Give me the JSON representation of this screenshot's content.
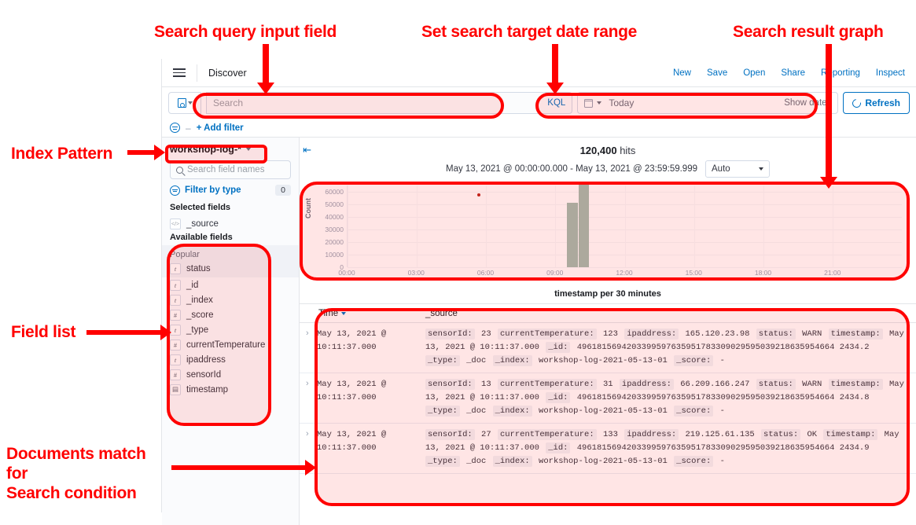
{
  "annotations": [
    {
      "id": "search-query",
      "text": "Search query input field"
    },
    {
      "id": "date-range",
      "text": "Set search target date range"
    },
    {
      "id": "result-graph",
      "text": "Search result graph"
    },
    {
      "id": "index-pattern",
      "text": "Index Pattern"
    },
    {
      "id": "field-list",
      "text": "Field list"
    },
    {
      "id": "documents",
      "text": "Documents match\nfor\nSearch condition"
    }
  ],
  "annotation_color": "#ff0000",
  "topnav": {
    "menu_icon": "hamburger-icon",
    "app_title": "Discover",
    "links": [
      "New",
      "Save",
      "Open",
      "Share",
      "Reporting",
      "Inspect"
    ]
  },
  "query_bar": {
    "saved_query_icon": "save-disk-icon",
    "search_placeholder": "Search",
    "query_language": "KQL",
    "date_icon": "calendar-icon",
    "date_value": "Today",
    "show_dates": "Show dates",
    "refresh_label": "Refresh",
    "refresh_icon": "refresh-icon"
  },
  "filter_bar": {
    "filter_icon": "filter-icon",
    "dash": "–",
    "add_filter": "+ Add filter"
  },
  "sidebar": {
    "index_pattern": "workshop-log-*",
    "collapse_icon": "collapse-panel-icon",
    "field_search_placeholder": "Search field names",
    "filter_by_type": "Filter by type",
    "filter_by_type_count": "0",
    "selected_fields_title": "Selected fields",
    "selected_fields": [
      {
        "name": "_source",
        "type": "source"
      }
    ],
    "available_fields_title": "Available fields",
    "popular_title": "Popular",
    "popular_fields": [
      {
        "name": "status",
        "type": "t"
      }
    ],
    "available_fields": [
      {
        "name": "_id",
        "type": "t"
      },
      {
        "name": "_index",
        "type": "t"
      },
      {
        "name": "_score",
        "type": "#"
      },
      {
        "name": "_type",
        "type": "t"
      },
      {
        "name": "currentTemperature",
        "type": "#"
      },
      {
        "name": "ipaddress",
        "type": "t"
      },
      {
        "name": "sensorId",
        "type": "#"
      },
      {
        "name": "timestamp",
        "type": "date"
      }
    ]
  },
  "main": {
    "hits_count": "120,400",
    "hits_label": "hits",
    "time_range": "May 13, 2021 @ 00:00:00.000 - May 13, 2021 @ 23:59:59.999",
    "interval_selected": "Auto"
  },
  "chart_data": {
    "type": "bar",
    "title": "",
    "xlabel": "timestamp per 30 minutes",
    "ylabel": "Count",
    "ylim": [
      0,
      65000
    ],
    "yticks": [
      0,
      10000,
      20000,
      30000,
      40000,
      50000,
      60000
    ],
    "xlim_hours": [
      0,
      24
    ],
    "xticks": [
      "00:00",
      "03:00",
      "06:00",
      "09:00",
      "12:00",
      "15:00",
      "18:00",
      "21:00"
    ],
    "xtick_hours": [
      0,
      3,
      6,
      9,
      12,
      15,
      18,
      21
    ],
    "grid": true,
    "legend": "none",
    "bar_color": "#a3bdaf",
    "categories": [
      "09:30",
      "10:00"
    ],
    "values": [
      51000,
      65500
    ],
    "annotation_points": [
      {
        "x_hour": 5.6,
        "y": 59000,
        "color": "#bd271e"
      }
    ]
  },
  "table": {
    "columns": [
      "Time",
      "_source"
    ],
    "sort_icon": "sort-desc-icon",
    "expand_icon": "expand-row-icon",
    "rows": [
      {
        "time": "May 13, 2021 @ 10:11:37.000",
        "fields": [
          {
            "k": "sensorId:",
            "v": "23"
          },
          {
            "k": "currentTemperature:",
            "v": "123"
          },
          {
            "k": "ipaddress:",
            "v": "165.120.23.98"
          },
          {
            "k": "status:",
            "v": "WARN"
          },
          {
            "k": "timestamp:",
            "v": "May 13, 2021 @ 10:11:37.000"
          },
          {
            "k": "_id:",
            "v": "4961815694203399597635951783309029595039218635954664 2434.2"
          },
          {
            "k": "_type:",
            "v": "_doc"
          },
          {
            "k": "_index:",
            "v": "workshop-log-2021-05-13-01"
          },
          {
            "k": "_score:",
            "v": "-"
          }
        ]
      },
      {
        "time": "May 13, 2021 @ 10:11:37.000",
        "fields": [
          {
            "k": "sensorId:",
            "v": "13"
          },
          {
            "k": "currentTemperature:",
            "v": "31"
          },
          {
            "k": "ipaddress:",
            "v": "66.209.166.247"
          },
          {
            "k": "status:",
            "v": "WARN"
          },
          {
            "k": "timestamp:",
            "v": "May 13, 2021 @ 10:11:37.000"
          },
          {
            "k": "_id:",
            "v": "4961815694203399597635951783309029595039218635954664 2434.8"
          },
          {
            "k": "_type:",
            "v": "_doc"
          },
          {
            "k": "_index:",
            "v": "workshop-log-2021-05-13-01"
          },
          {
            "k": "_score:",
            "v": "-"
          }
        ]
      },
      {
        "time": "May 13, 2021 @ 10:11:37.000",
        "fields": [
          {
            "k": "sensorId:",
            "v": "27"
          },
          {
            "k": "currentTemperature:",
            "v": "133"
          },
          {
            "k": "ipaddress:",
            "v": "219.125.61.135"
          },
          {
            "k": "status:",
            "v": "OK"
          },
          {
            "k": "timestamp:",
            "v": "May 13, 2021 @ 10:11:37.000"
          },
          {
            "k": "_id:",
            "v": "4961815694203399597635951783309029595039218635954664 2434.9"
          },
          {
            "k": "_type:",
            "v": "_doc"
          },
          {
            "k": "_index:",
            "v": "workshop-log-2021-05-13-01"
          },
          {
            "k": "_score:",
            "v": "-"
          }
        ]
      }
    ]
  }
}
